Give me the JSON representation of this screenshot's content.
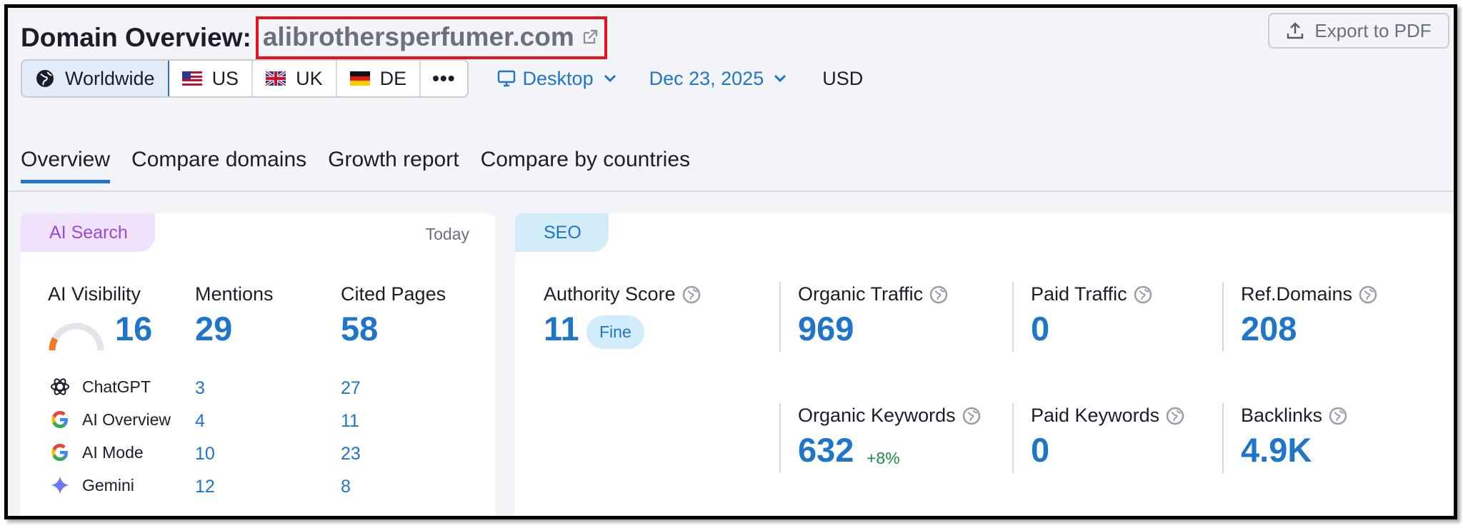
{
  "header": {
    "title": "Domain Overview:",
    "domain": "alibrothersperfumer.com",
    "export_label": "Export to PDF"
  },
  "databases": [
    {
      "label": "Worldwide",
      "icon": "globe-icon",
      "active": true
    },
    {
      "label": "US",
      "icon": "us-flag-icon"
    },
    {
      "label": "UK",
      "icon": "uk-flag-icon"
    },
    {
      "label": "DE",
      "icon": "de-flag-icon"
    },
    {
      "label": "•••",
      "icon": "more-icon"
    }
  ],
  "device": {
    "label": "Desktop",
    "icon": "desktop-icon"
  },
  "date": {
    "label": "Dec 23, 2025"
  },
  "currency": "USD",
  "tabs": [
    {
      "label": "Overview",
      "active": true
    },
    {
      "label": "Compare domains"
    },
    {
      "label": "Growth report"
    },
    {
      "label": "Compare by countries"
    }
  ],
  "ai_search": {
    "tag": "AI Search",
    "period": "Today",
    "visibility_label": "AI Visibility",
    "visibility_value": "16",
    "visibility_level": 0.16,
    "mentions_label": "Mentions",
    "mentions_value": "29",
    "cited_label": "Cited Pages",
    "cited_value": "58",
    "engines": [
      {
        "name": "ChatGPT",
        "icon": "chatgpt-icon",
        "mentions": "3",
        "cited": "27"
      },
      {
        "name": "AI Overview",
        "icon": "google-icon",
        "mentions": "4",
        "cited": "11"
      },
      {
        "name": "AI Mode",
        "icon": "google-icon",
        "mentions": "10",
        "cited": "23"
      },
      {
        "name": "Gemini",
        "icon": "gemini-icon",
        "mentions": "12",
        "cited": "8"
      }
    ]
  },
  "seo": {
    "tag": "SEO",
    "authority_label": "Authority Score",
    "authority_value": "11",
    "authority_badge": "Fine",
    "organic_traffic_label": "Organic Traffic",
    "organic_traffic_value": "969",
    "paid_traffic_label": "Paid Traffic",
    "paid_traffic_value": "0",
    "ref_domains_label": "Ref.Domains",
    "ref_domains_value": "208",
    "organic_keywords_label": "Organic Keywords",
    "organic_keywords_value": "632",
    "organic_keywords_change": "+8%",
    "paid_keywords_label": "Paid Keywords",
    "paid_keywords_value": "0",
    "backlinks_label": "Backlinks",
    "backlinks_value": "4.9K"
  },
  "colors": {
    "accent_blue": "#1f75c9",
    "highlight_red": "#e8121c",
    "ai_purple": "#9a48dc",
    "positive_green": "#1b8c4a"
  }
}
